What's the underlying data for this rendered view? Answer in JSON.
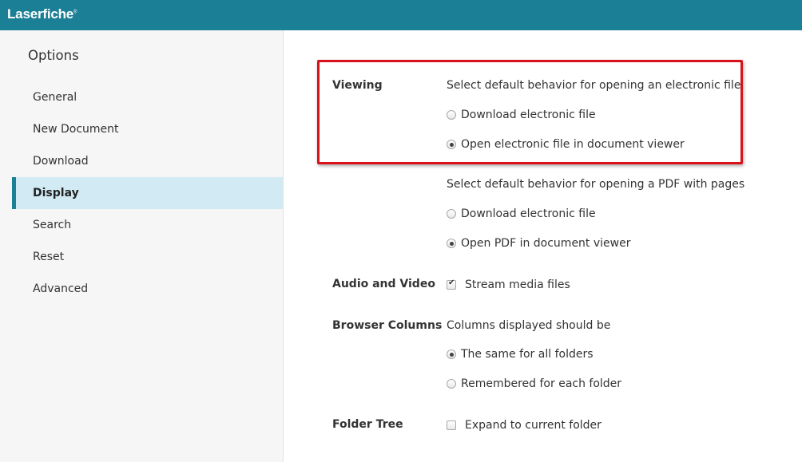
{
  "app": {
    "logo": "Laserfiche"
  },
  "sidebar": {
    "title": "Options",
    "items": [
      {
        "label": "General",
        "active": false
      },
      {
        "label": "New Document",
        "active": false
      },
      {
        "label": "Download",
        "active": false
      },
      {
        "label": "Display",
        "active": true
      },
      {
        "label": "Search",
        "active": false
      },
      {
        "label": "Reset",
        "active": false
      },
      {
        "label": "Advanced",
        "active": false
      }
    ]
  },
  "viewing": {
    "label": "Viewing",
    "electronic": {
      "prompt": "Select default behavior for opening an electronic file",
      "options": [
        {
          "label": "Download electronic file",
          "selected": false
        },
        {
          "label": "Open electronic file in document viewer",
          "selected": true
        }
      ]
    },
    "pdf": {
      "prompt": "Select default behavior for opening a PDF with pages",
      "options": [
        {
          "label": "Download electronic file",
          "selected": false
        },
        {
          "label": "Open PDF in document viewer",
          "selected": true
        }
      ]
    }
  },
  "audio_video": {
    "label": "Audio and Video",
    "stream_label": "Stream media files",
    "stream_checked": true
  },
  "browser_columns": {
    "label": "Browser Columns",
    "prompt": "Columns displayed should be",
    "options": [
      {
        "label": "The same for all folders",
        "selected": true
      },
      {
        "label": "Remembered for each folder",
        "selected": false
      }
    ]
  },
  "folder_tree": {
    "label": "Folder Tree",
    "expand_label": "Expand to current folder",
    "expand_checked": false
  },
  "colors": {
    "header": "#1b7f95",
    "highlight": "#d8111b",
    "active_nav": "#d2eaf3"
  }
}
